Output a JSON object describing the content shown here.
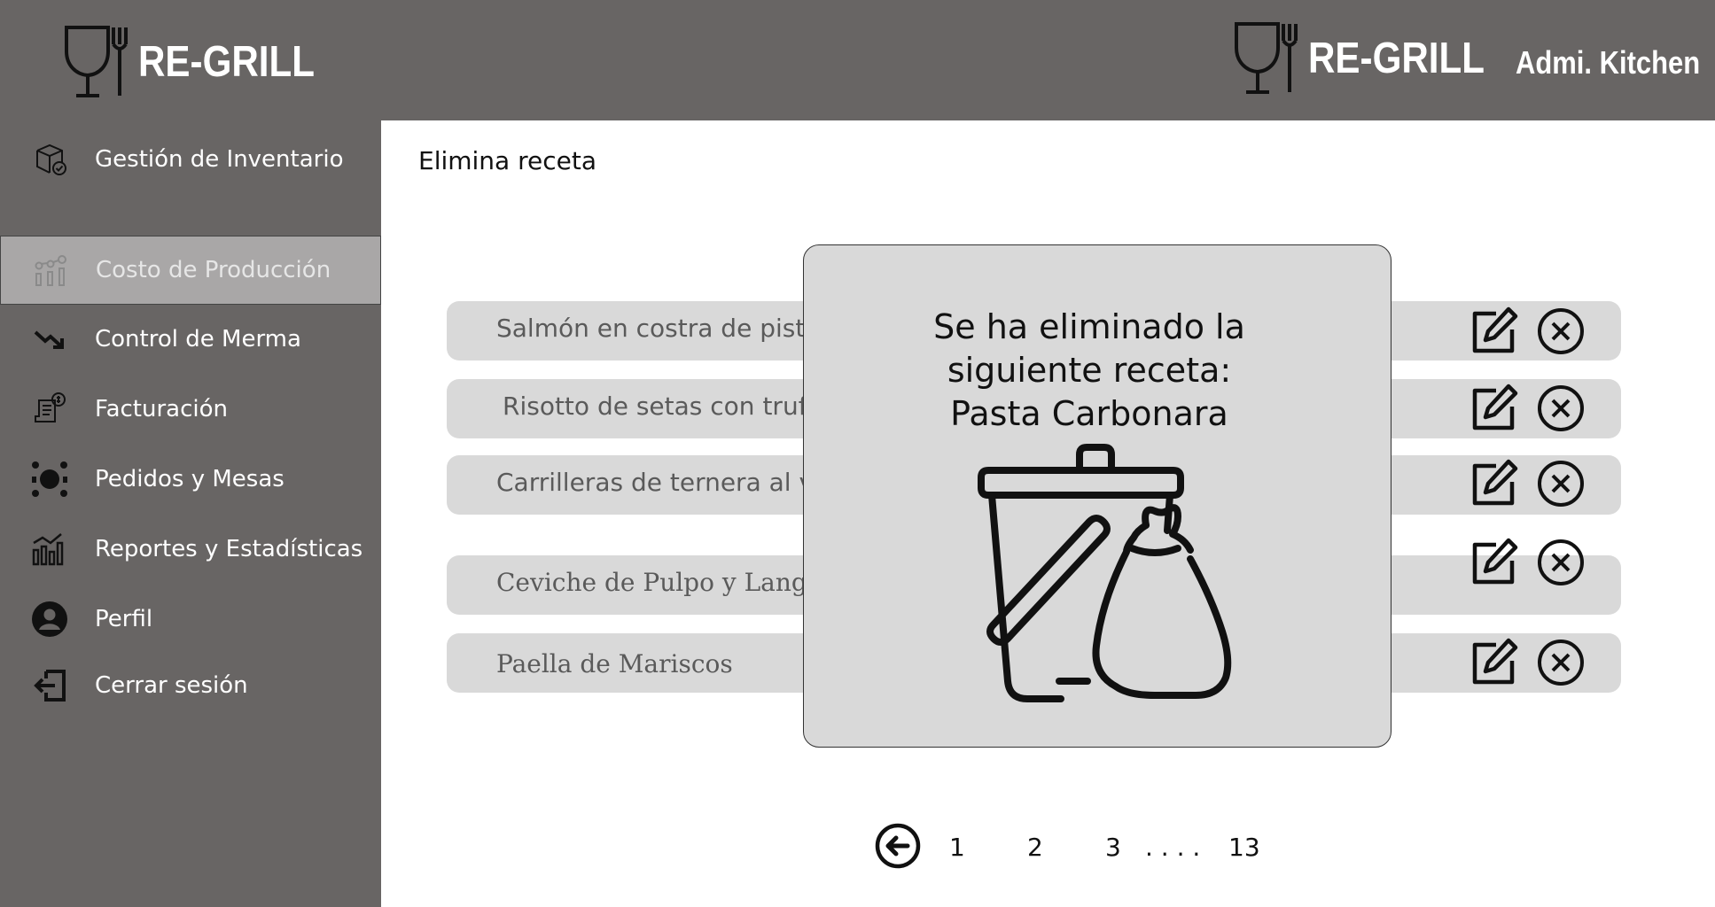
{
  "header": {
    "brand_left": "RE-GRILL",
    "brand_right": "RE-GRILL",
    "user_label": "Admi. Kitchen"
  },
  "sidebar": {
    "items": [
      {
        "label": "Gestión de Inventario",
        "icon": "inventory-box-icon"
      },
      {
        "label": "Costo de Producción",
        "icon": "production-cost-icon",
        "active": true
      },
      {
        "label": "Control de Merma",
        "icon": "trend-down-icon"
      },
      {
        "label": "Facturación",
        "icon": "invoice-icon"
      },
      {
        "label": "Pedidos y Mesas",
        "icon": "orders-tables-icon"
      },
      {
        "label": "Reportes y Estadísticas",
        "icon": "stats-chart-icon"
      },
      {
        "label": "Perfil",
        "icon": "user-icon"
      },
      {
        "label": "Cerrar sesión",
        "icon": "logout-icon"
      }
    ]
  },
  "main": {
    "title": "Elimina receta",
    "recipes": [
      {
        "name": "Salmón en costra de pista"
      },
      {
        "name": "Risotto de setas con trufa"
      },
      {
        "name": "Carrilleras de ternera al vi"
      },
      {
        "name": "Ceviche de Pulpo y Langost"
      },
      {
        "name": "Paella de Mariscos"
      }
    ]
  },
  "modal": {
    "line1": "Se ha eliminado la",
    "line2": "siguiente receta:",
    "line3": "Pasta Carbonara",
    "icon": "trash-bin-bag-icon"
  },
  "pagination": {
    "pages": [
      "1",
      "2",
      "3"
    ],
    "ellipsis": ". . . .",
    "last": "13"
  },
  "colors": {
    "header_bg": "#686564",
    "sidebar_bg": "#686564",
    "active_item_bg": "#a9a7a7",
    "row_bg": "#d9d9d9",
    "modal_bg": "#d9d9d9"
  }
}
